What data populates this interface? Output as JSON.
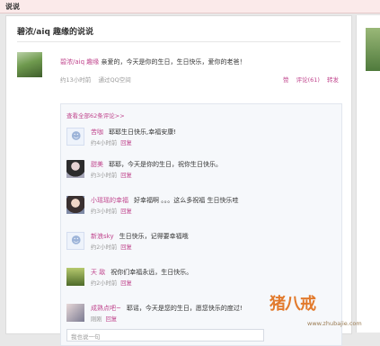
{
  "header": {
    "title": "说说"
  },
  "page": {
    "title": "碧浓/aiq 趣缘的说说"
  },
  "post": {
    "author": "碧浓/aiq 趣缘",
    "text": "亲爱的，今天是你的生日，生日快乐，爱你的老爸！",
    "time": "约13小时前",
    "source": "通过QQ空间",
    "like": "赞",
    "comments": "评论(61)",
    "forward": "转发"
  },
  "comments_box": {
    "view_all": "查看全部62条评论>>",
    "items": [
      {
        "name": "苦咖",
        "text": "耶耶生日快乐,幸福安康!",
        "time": "约4小时前",
        "reply": "回复",
        "avatar": "default"
      },
      {
        "name": "甜美",
        "text": "耶耶，今天是你的生日，祝你生日快乐。",
        "time": "约3小时前",
        "reply": "回复",
        "avatar": "girl1"
      },
      {
        "name": "小瑶瑶的幸福",
        "text": "好幸福啊 。。。这么多祝福 生日快乐哇",
        "time": "约3小时前",
        "reply": "回复",
        "avatar": "girl2"
      },
      {
        "name": "新浪sky",
        "text": "生日快乐，记得要幸福哦",
        "time": "约2小时前",
        "reply": "回复",
        "avatar": "default"
      },
      {
        "name": "天 敌",
        "text": "祝你们幸福永远，生日快乐。",
        "time": "约2小时前",
        "reply": "回复",
        "avatar": "land"
      },
      {
        "name": "成熟点吧~",
        "text": "耶谣，今天是您的生日，愿您快乐的度过!",
        "time": "刚刚",
        "reply": "回复",
        "avatar": "hand"
      }
    ],
    "reply_placeholder": "我也说一句"
  },
  "watermark": {
    "logo": "猪八戒",
    "url": "www.zhubajie.com"
  },
  "icons": {
    "default_avatar": "person-silhouette-icon"
  },
  "colors": {
    "accent": "#c0458d",
    "meta": "#999999"
  }
}
